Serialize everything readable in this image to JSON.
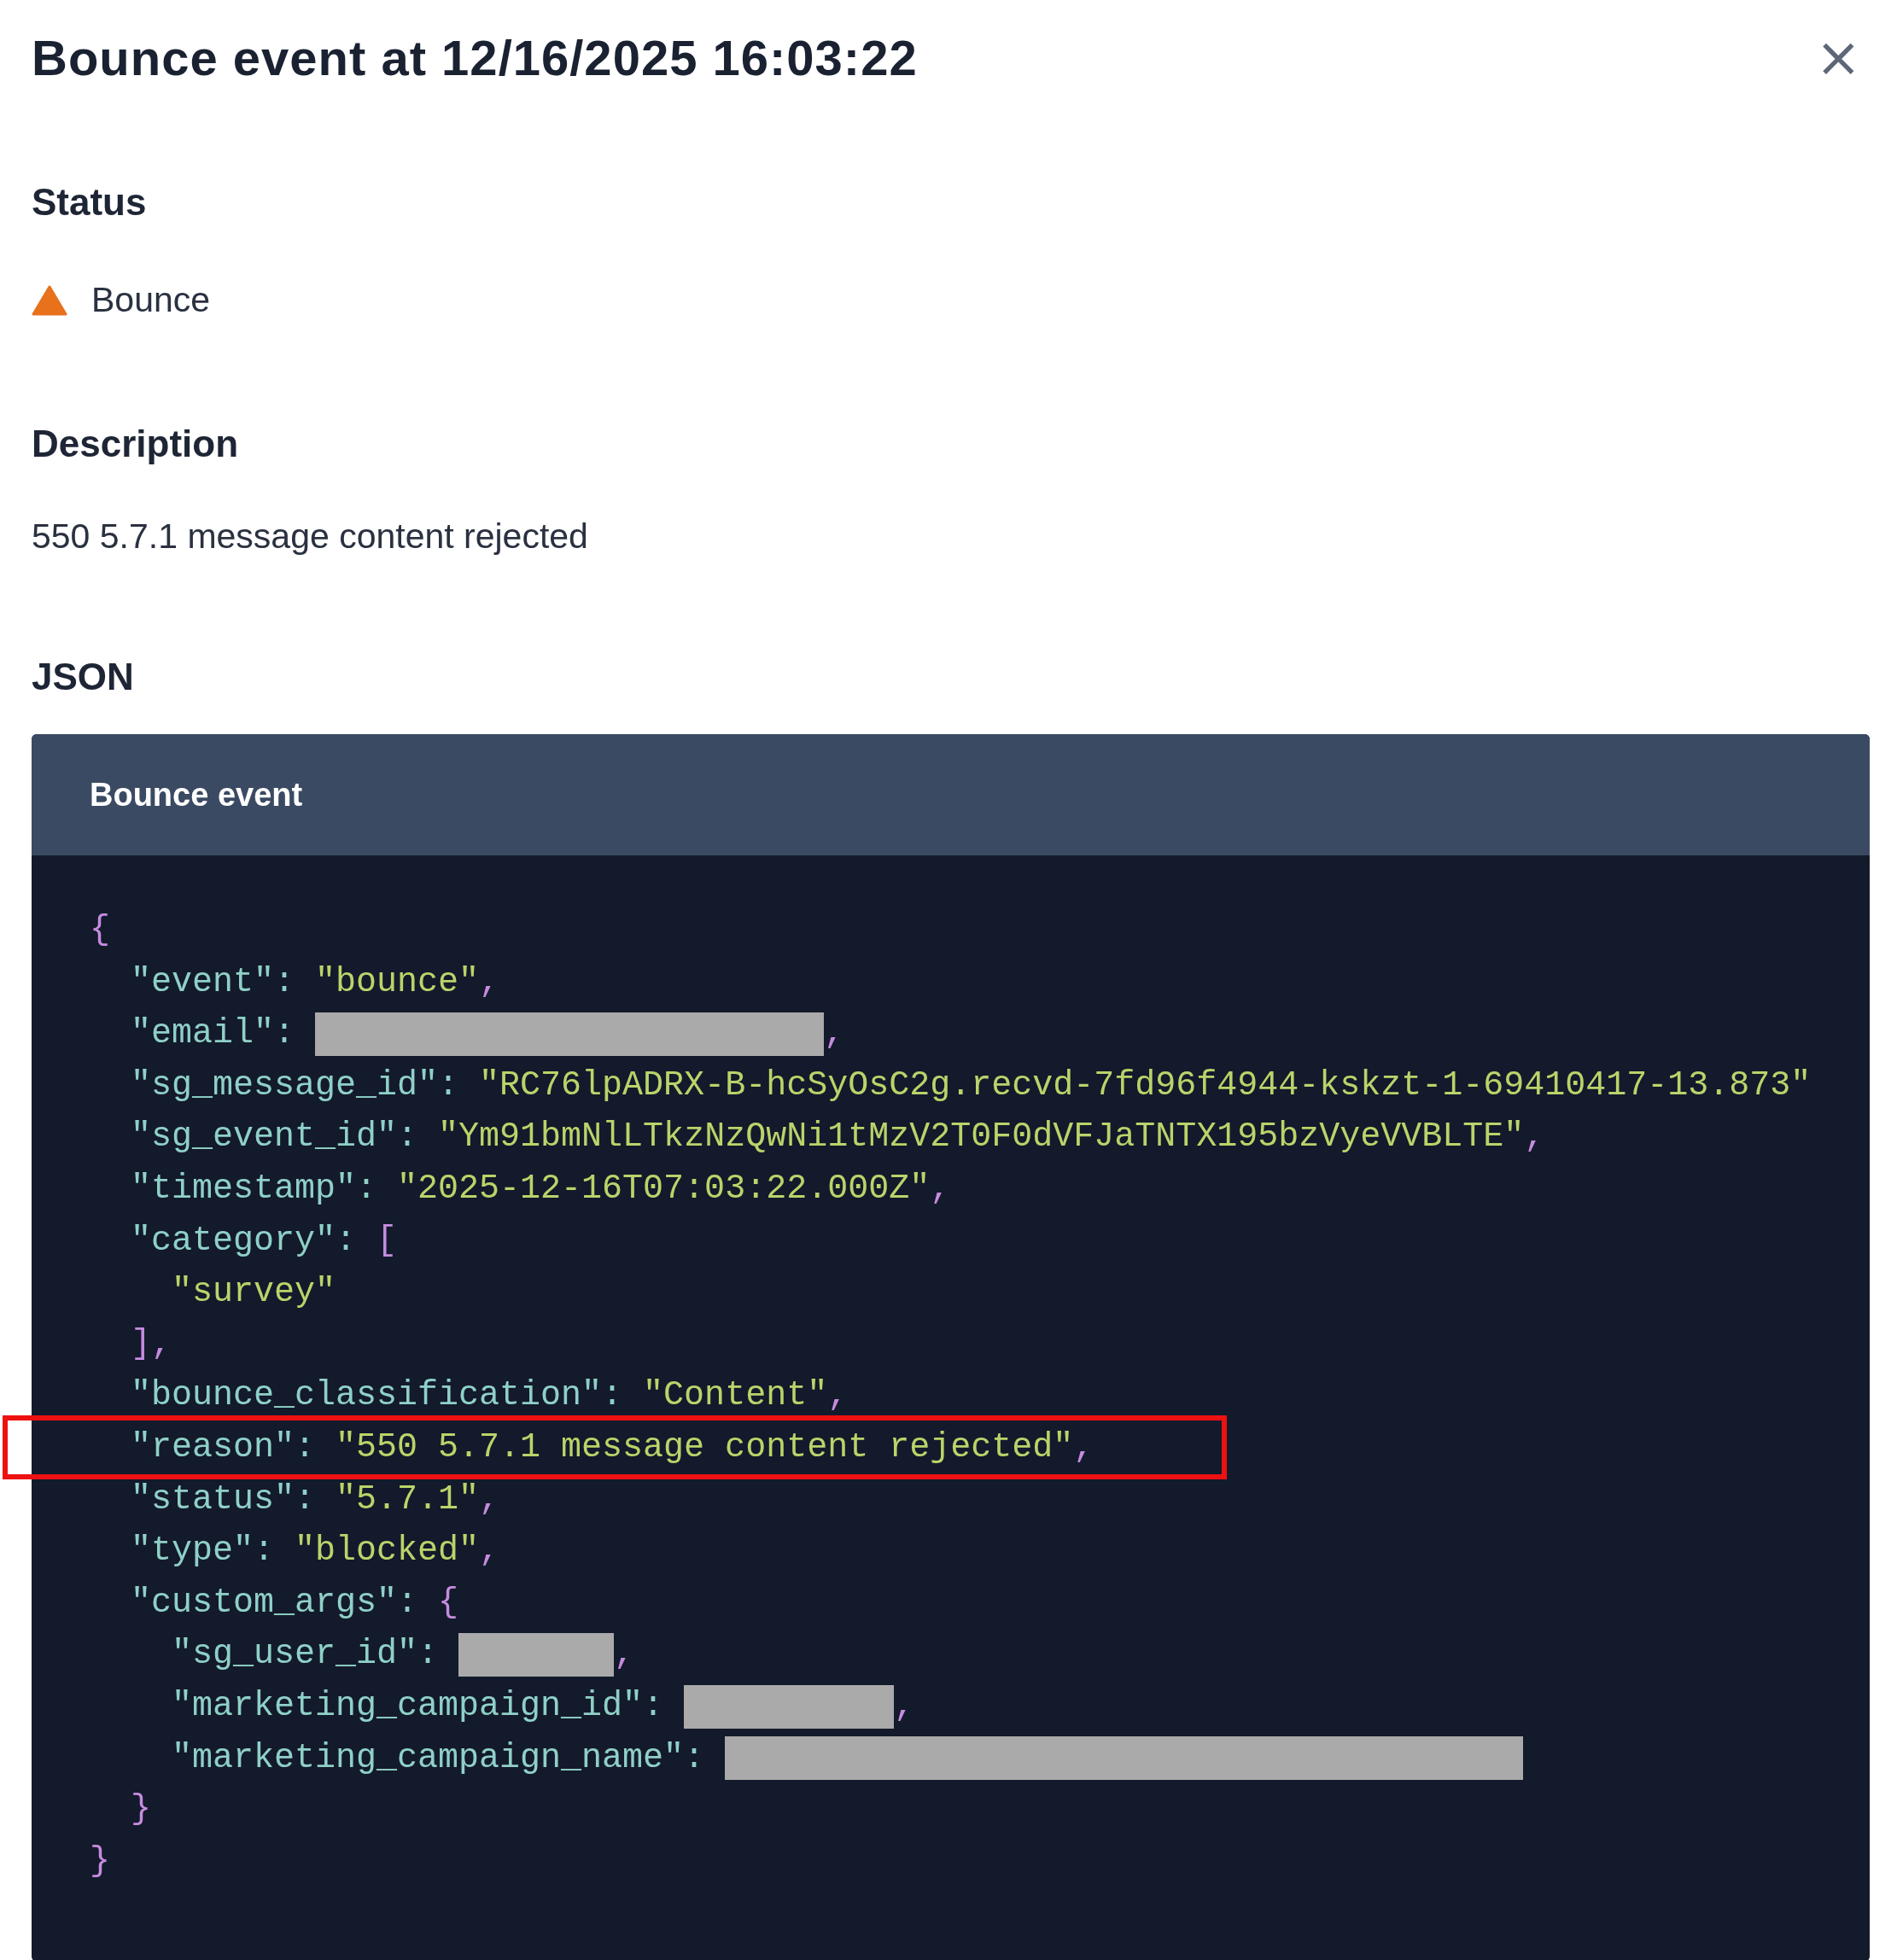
{
  "drawer": {
    "title": "Bounce event at 12/16/2025 16:03:22",
    "close": "×"
  },
  "status": {
    "heading": "Status",
    "label": "Bounce",
    "kind": "warning"
  },
  "description": {
    "heading": "Description",
    "text": "550 5.7.1 message content rejected"
  },
  "json_section": {
    "heading": "JSON",
    "panel_title": "Bounce event",
    "lines": [
      {
        "tokens": [
          {
            "kind": "punct",
            "text": "{"
          }
        ],
        "children": [
          {
            "tokens": [
              {
                "kind": "key",
                "text": "\"event\""
              },
              {
                "kind": "colon",
                "text": ":"
              },
              {
                "kind": "string",
                "text": "\"bounce\""
              },
              {
                "kind": "punct",
                "text": ","
              }
            ]
          },
          {
            "tokens": [
              {
                "kind": "key",
                "text": "\"email\""
              },
              {
                "kind": "colon",
                "text": ":"
              },
              {
                "kind": "redacted_long"
              },
              {
                "kind": "punct",
                "text": ","
              }
            ]
          },
          {
            "tokens": [
              {
                "kind": "key",
                "text": "\"sg_message_id\""
              },
              {
                "kind": "colon",
                "text": ":"
              },
              {
                "kind": "string",
                "text": "\"RC76lpADRX-B-hcSyOsC2g.recvd-7fd96f4944-kskzt-1-69410417-13.873\""
              }
            ]
          },
          {
            "tokens": [
              {
                "kind": "key",
                "text": "\"sg_event_id\""
              },
              {
                "kind": "colon",
                "text": ":"
              },
              {
                "kind": "string",
                "text": "\"Ym91bmNlLTkzNzQwNi1tMzV2T0F0dVFJaTNTX195bzVyeVVBLTE\""
              },
              {
                "kind": "punct",
                "text": ","
              }
            ]
          },
          {
            "tokens": [
              {
                "kind": "key",
                "text": "\"timestamp\""
              },
              {
                "kind": "colon",
                "text": ":"
              },
              {
                "kind": "string",
                "text": "\"2025-12-16T07:03:22.000Z\""
              },
              {
                "kind": "punct",
                "text": ","
              }
            ]
          },
          {
            "tokens": [
              {
                "kind": "key",
                "text": "\"category\""
              },
              {
                "kind": "colon",
                "text": ":"
              },
              {
                "kind": "punct",
                "text": "["
              }
            ],
            "children": [
              {
                "tokens": [
                  {
                    "kind": "string",
                    "text": "\"survey\""
                  }
                ]
              }
            ]
          },
          {
            "tokens": [
              {
                "kind": "punct",
                "text": "],"
              }
            ]
          },
          {
            "tokens": [
              {
                "kind": "key",
                "text": "\"bounce_classification\""
              },
              {
                "kind": "colon",
                "text": ":"
              },
              {
                "kind": "string",
                "text": "\"Content\""
              },
              {
                "kind": "punct",
                "text": ","
              }
            ]
          },
          {
            "highlighted": true,
            "tokens": [
              {
                "kind": "key",
                "text": "\"reason\""
              },
              {
                "kind": "colon",
                "text": ":"
              },
              {
                "kind": "string",
                "text": "\"550 5.7.1 message content rejected\""
              },
              {
                "kind": "punct",
                "text": ","
              }
            ]
          },
          {
            "tokens": [
              {
                "kind": "key",
                "text": "\"status\""
              },
              {
                "kind": "colon",
                "text": ":"
              },
              {
                "kind": "string",
                "text": "\"5.7.1\""
              },
              {
                "kind": "punct",
                "text": ","
              }
            ]
          },
          {
            "tokens": [
              {
                "kind": "key",
                "text": "\"type\""
              },
              {
                "kind": "colon",
                "text": ":"
              },
              {
                "kind": "string",
                "text": "\"blocked\""
              },
              {
                "kind": "punct",
                "text": ","
              }
            ]
          },
          {
            "tokens": [
              {
                "kind": "key",
                "text": "\"custom_args\""
              },
              {
                "kind": "colon",
                "text": ":"
              },
              {
                "kind": "punct",
                "text": "{"
              }
            ],
            "children": [
              {
                "tokens": [
                  {
                    "kind": "key",
                    "text": "\"sg_user_id\""
                  },
                  {
                    "kind": "colon",
                    "text": ":"
                  },
                  {
                    "kind": "redacted_short"
                  },
                  {
                    "kind": "punct",
                    "text": ","
                  }
                ]
              },
              {
                "tokens": [
                  {
                    "kind": "key",
                    "text": "\"marketing_campaign_id\""
                  },
                  {
                    "kind": "colon",
                    "text": ":"
                  },
                  {
                    "kind": "redacted_medium"
                  },
                  {
                    "kind": "punct",
                    "text": ","
                  }
                ]
              },
              {
                "tokens": [
                  {
                    "kind": "key",
                    "text": "\"marketing_campaign_name\""
                  },
                  {
                    "kind": "colon",
                    "text": ":"
                  },
                  {
                    "kind": "redacted_wide"
                  }
                ]
              }
            ]
          },
          {
            "tokens": [
              {
                "kind": "punct",
                "text": "}"
              }
            ]
          }
        ]
      },
      {
        "tokens": [
          {
            "kind": "punct",
            "text": "}"
          }
        ]
      }
    ]
  }
}
